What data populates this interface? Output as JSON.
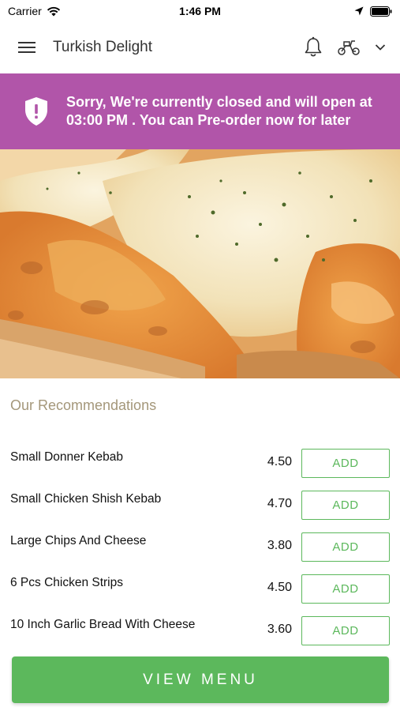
{
  "status_bar": {
    "carrier": "Carrier",
    "time": "1:46 PM"
  },
  "header": {
    "title": "Turkish Delight",
    "icons": [
      "menu-icon",
      "bell-icon",
      "scooter-icon",
      "chevron-down-icon"
    ]
  },
  "banner": {
    "message": "Sorry, We're currently closed and will open at 03:00 PM . You can Pre-order now for later",
    "background": "#b155a9",
    "icon": "shield-alert-icon"
  },
  "recommendations": {
    "title": "Our Recommendations",
    "items": [
      {
        "name": "Small Donner Kebab",
        "price": "4.50",
        "action": "ADD"
      },
      {
        "name": "Small Chicken Shish Kebab",
        "price": "4.70",
        "action": "ADD"
      },
      {
        "name": "Large Chips And Cheese",
        "price": "3.80",
        "action": "ADD"
      },
      {
        "name": "6 Pcs Chicken Strips",
        "price": "4.50",
        "action": "ADD"
      },
      {
        "name": "10 Inch Garlic Bread With Cheese",
        "price": "3.60",
        "action": "ADD"
      }
    ]
  },
  "view_menu": {
    "label": "VIEW MENU"
  },
  "colors": {
    "accent_green": "#5cb85c",
    "banner_purple": "#b155a9",
    "section_title": "#a4977a"
  }
}
